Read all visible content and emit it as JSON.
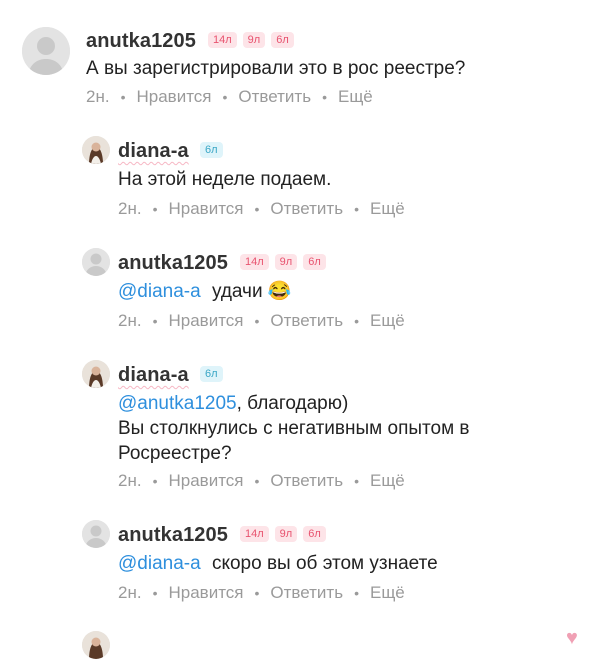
{
  "comments": [
    {
      "user": "anutka1205",
      "badges": [
        "14л",
        "9л",
        "6л"
      ],
      "text": "А вы зарегистрировали это в рос реестре?",
      "time": "2н.",
      "like": "Нравится",
      "reply": "Ответить",
      "more": "Ещё"
    },
    {
      "user": "diana-a",
      "badges": [
        "6л"
      ],
      "text": "На этой неделе подаем.",
      "time": "2н.",
      "like": "Нравится",
      "reply": "Ответить",
      "more": "Ещё"
    },
    {
      "user": "anutka1205",
      "badges": [
        "14л",
        "9л",
        "6л"
      ],
      "mention": "@diana-a",
      "text": "удачи",
      "emoji": "😂",
      "time": "2н.",
      "like": "Нравится",
      "reply": "Ответить",
      "more": "Ещё"
    },
    {
      "user": "diana-a",
      "badges": [
        "6л"
      ],
      "mention": "@anutka1205",
      "text_line1": ", благодарю)",
      "text_line2": "Вы столкнулись с негативным опытом в",
      "text_line3": "Росреестре?",
      "time": "2н.",
      "like": "Нравится",
      "reply": "Ответить",
      "more": "Ещё"
    },
    {
      "user": "anutka1205",
      "badges": [
        "14л",
        "9л",
        "6л"
      ],
      "mention": "@diana-a",
      "text": "скоро вы об этом узнаете",
      "time": "2н.",
      "like": "Нравится",
      "reply": "Ответить",
      "more": "Ещё"
    }
  ],
  "icons": {
    "default_avatar": "default-avatar-icon",
    "user_photo": "user-photo-avatar",
    "heart": "heart-icon"
  },
  "colors": {
    "mention": "#2e8fdd",
    "badge_pink_bg": "#fde4e8",
    "badge_pink_text": "#e8536f",
    "badge_cyan_bg": "#dff4fa",
    "badge_cyan_text": "#3aa7c6",
    "meta": "#9a9a9a"
  }
}
